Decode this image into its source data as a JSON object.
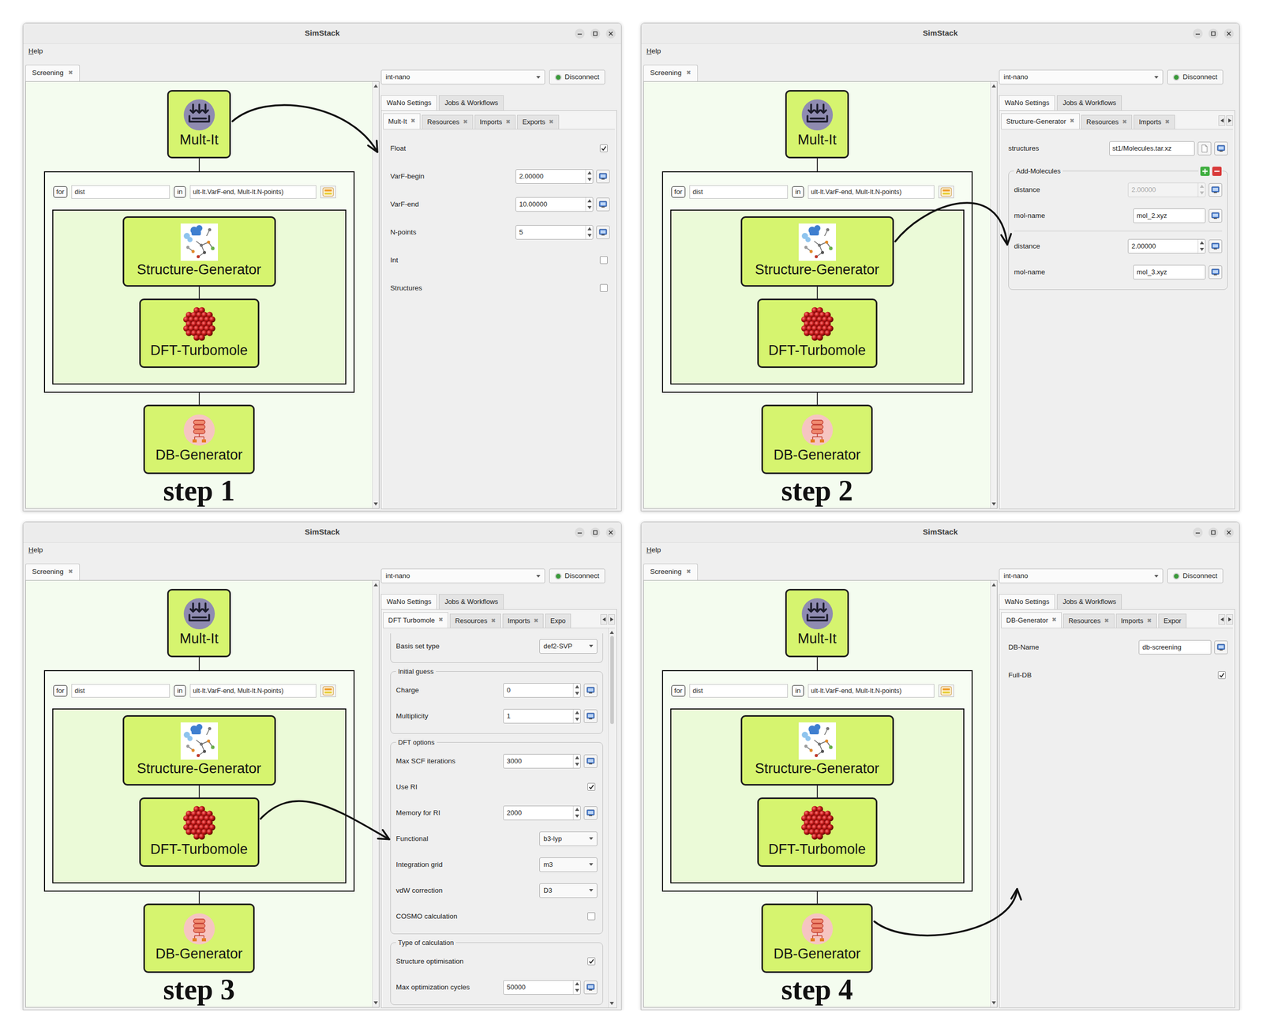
{
  "panels": [
    {
      "window": {
        "title": "SimStack"
      },
      "menu": [
        {
          "label": "Help"
        }
      ],
      "workflow_tabs": [
        {
          "label": "Screening",
          "close": "✖",
          "selected": true
        }
      ],
      "workflow": {
        "top": {
          "label": "Mult-It",
          "kind": "mult-it",
          "selected": true
        },
        "loop": {
          "keyword": "for",
          "variable": "dist",
          "in": "in",
          "iterable": "ult-It.VarF-end, Mult-It.N-points)"
        },
        "loop_nodes": [
          {
            "label": "Structure-Generator",
            "kind": "structure",
            "selected": false
          },
          {
            "label": "DFT-Turbomole",
            "kind": "dft",
            "selected": false
          }
        ],
        "bottom": {
          "label": "DB-Generator",
          "kind": "db",
          "selected": false
        }
      },
      "step_label": "step 1",
      "server": "int-nano",
      "connected": true,
      "connect_button": "Disconnect",
      "main_tabs": [
        {
          "label": "WaNo Settings",
          "selected": true
        },
        {
          "label": "Jobs & Workflows",
          "selected": false
        }
      ],
      "sub_tabs": [
        {
          "label": "Mult-It",
          "close": "✖",
          "selected": true
        },
        {
          "label": "Resources",
          "close": "✖",
          "selected": false
        },
        {
          "label": "Imports",
          "close": "✖",
          "selected": false
        },
        {
          "label": "Exports",
          "close": "✖",
          "selected": false
        }
      ],
      "sub_tab_arrows": false,
      "settings_scrollbar": false,
      "settings": [
        {
          "kind": "checkbox",
          "label": "Float",
          "checked": true
        },
        {
          "kind": "spin",
          "label": "VarF-begin",
          "value": "2.00000",
          "disabled": false
        },
        {
          "kind": "spin",
          "label": "VarF-end",
          "value": "10.00000",
          "disabled": false
        },
        {
          "kind": "spin",
          "label": "N-points",
          "value": "5",
          "disabled": false
        },
        {
          "kind": "checkbox",
          "label": "Int",
          "checked": false
        },
        {
          "kind": "checkbox",
          "label": "Structures",
          "checked": false
        }
      ]
    },
    {
      "window": {
        "title": "SimStack"
      },
      "menu": [
        {
          "label": "Help"
        }
      ],
      "workflow_tabs": [
        {
          "label": "Screening",
          "close": "✖",
          "selected": true
        }
      ],
      "workflow": {
        "top": {
          "label": "Mult-It",
          "kind": "mult-it",
          "selected": false
        },
        "loop": {
          "keyword": "for",
          "variable": "dist",
          "in": "in",
          "iterable": "ult-It.VarF-end, Mult-It.N-points)"
        },
        "loop_nodes": [
          {
            "label": "Structure-Generator",
            "kind": "structure",
            "selected": true
          },
          {
            "label": "DFT-Turbomole",
            "kind": "dft",
            "selected": false
          }
        ],
        "bottom": {
          "label": "DB-Generator",
          "kind": "db",
          "selected": false
        }
      },
      "step_label": "step 2",
      "server": "int-nano",
      "connected": true,
      "connect_button": "Disconnect",
      "main_tabs": [
        {
          "label": "WaNo Settings",
          "selected": true
        },
        {
          "label": "Jobs & Workflows",
          "selected": false
        }
      ],
      "sub_tabs": [
        {
          "label": "Structure-Generator",
          "close": "✖",
          "selected": true
        },
        {
          "label": "Resources",
          "close": "✖",
          "selected": false
        },
        {
          "label": "Imports",
          "close": "✖",
          "selected": false
        }
      ],
      "sub_tab_arrows": true,
      "settings_scrollbar": false,
      "settings": [
        {
          "kind": "file",
          "label": "structures",
          "value": "st1/Molecules.tar.xz"
        },
        {
          "kind": "group",
          "title": "Add-Molecules",
          "add_remove": true,
          "items": [
            {
              "kind": "spin",
              "label": "distance",
              "value": "2.00000",
              "disabled": true
            },
            {
              "kind": "text",
              "label": "mol-name",
              "value": "mol_2.xyz"
            },
            {
              "kind": "separator"
            },
            {
              "kind": "spin",
              "label": "distance",
              "value": "2.00000",
              "disabled": false
            },
            {
              "kind": "text",
              "label": "mol-name",
              "value": "mol_3.xyz"
            }
          ]
        }
      ]
    },
    {
      "window": {
        "title": "SimStack"
      },
      "menu": [
        {
          "label": "Help"
        }
      ],
      "workflow_tabs": [
        {
          "label": "Screening",
          "close": "✖",
          "selected": true
        }
      ],
      "workflow": {
        "top": {
          "label": "Mult-It",
          "kind": "mult-it",
          "selected": false
        },
        "loop": {
          "keyword": "for",
          "variable": "dist",
          "in": "in",
          "iterable": "ult-It.VarF-end, Mult-It.N-points)"
        },
        "loop_nodes": [
          {
            "label": "Structure-Generator",
            "kind": "structure",
            "selected": false
          },
          {
            "label": "DFT-Turbomole",
            "kind": "dft",
            "selected": true
          }
        ],
        "bottom": {
          "label": "DB-Generator",
          "kind": "db",
          "selected": false
        }
      },
      "step_label": "step 3",
      "server": "int-nano",
      "connected": true,
      "connect_button": "Disconnect",
      "main_tabs": [
        {
          "label": "WaNo Settings",
          "selected": true
        },
        {
          "label": "Jobs & Workflows",
          "selected": false
        }
      ],
      "sub_tabs": [
        {
          "label": "DFT Turbomole",
          "close": "✖",
          "selected": true
        },
        {
          "label": "Resources",
          "close": "✖",
          "selected": false
        },
        {
          "label": "Imports",
          "close": "✖",
          "selected": false
        },
        {
          "label": "Expo",
          "selected": false
        }
      ],
      "sub_tab_arrows": true,
      "settings_scrollbar": true,
      "settings": [
        {
          "kind": "group_tail",
          "items": [
            {
              "kind": "combo",
              "label": "Basis set type",
              "value": "def2-SVP"
            }
          ]
        },
        {
          "kind": "group",
          "title": "Initial guess",
          "add_remove": false,
          "items": [
            {
              "kind": "spin",
              "label": "Charge",
              "value": "0",
              "disabled": false
            },
            {
              "kind": "spin",
              "label": "Multiplicity",
              "value": "1",
              "disabled": false
            }
          ]
        },
        {
          "kind": "group",
          "title": "DFT options",
          "add_remove": false,
          "items": [
            {
              "kind": "spin",
              "label": "Max SCF iterations",
              "value": "3000",
              "disabled": false
            },
            {
              "kind": "checkbox",
              "label": "Use RI",
              "checked": true
            },
            {
              "kind": "spin",
              "label": "Memory for RI",
              "value": "2000",
              "disabled": false
            },
            {
              "kind": "combo",
              "label": "Functional",
              "value": "b3-lyp"
            },
            {
              "kind": "combo",
              "label": "Integration grid",
              "value": "m3"
            },
            {
              "kind": "combo",
              "label": "vdW correction",
              "value": "D3"
            },
            {
              "kind": "checkbox",
              "label": "COSMO calculation",
              "checked": false
            }
          ]
        },
        {
          "kind": "group",
          "title": "Type of calculation",
          "add_remove": false,
          "items": [
            {
              "kind": "checkbox",
              "label": "Structure optimisation",
              "checked": true
            },
            {
              "kind": "spin",
              "label": "Max optimization cycles",
              "value": "50000",
              "disabled": false
            }
          ]
        }
      ]
    },
    {
      "window": {
        "title": "SimStack"
      },
      "menu": [
        {
          "label": "Help"
        }
      ],
      "workflow_tabs": [
        {
          "label": "Screening",
          "close": "✖",
          "selected": true
        }
      ],
      "workflow": {
        "top": {
          "label": "Mult-It",
          "kind": "mult-it",
          "selected": false
        },
        "loop": {
          "keyword": "for",
          "variable": "dist",
          "in": "in",
          "iterable": "ult-It.VarF-end, Mult-It.N-points)"
        },
        "loop_nodes": [
          {
            "label": "Structure-Generator",
            "kind": "structure",
            "selected": false
          },
          {
            "label": "DFT-Turbomole",
            "kind": "dft",
            "selected": false
          }
        ],
        "bottom": {
          "label": "DB-Generator",
          "kind": "db",
          "selected": true
        }
      },
      "step_label": "step 4",
      "server": "int-nano",
      "connected": true,
      "connect_button": "Disconnect",
      "main_tabs": [
        {
          "label": "WaNo Settings",
          "selected": true
        },
        {
          "label": "Jobs & Workflows",
          "selected": false
        }
      ],
      "sub_tabs": [
        {
          "label": "DB-Generator",
          "close": "✖",
          "selected": true
        },
        {
          "label": "Resources",
          "close": "✖",
          "selected": false
        },
        {
          "label": "Imports",
          "close": "✖",
          "selected": false
        },
        {
          "label": "Expor",
          "selected": false
        }
      ],
      "sub_tab_arrows": true,
      "settings_scrollbar": false,
      "settings": [
        {
          "kind": "text",
          "label": "DB-Name",
          "value": "db-screening"
        },
        {
          "kind": "checkbox",
          "label": "Full-DB",
          "checked": true
        }
      ]
    }
  ]
}
